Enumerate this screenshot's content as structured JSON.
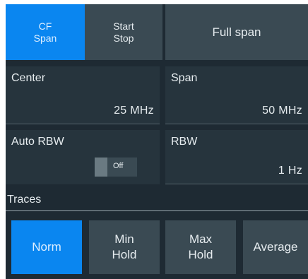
{
  "span_mode": {
    "cf_span": {
      "line1": "CF",
      "line2": "Span"
    },
    "start_stop": {
      "line1": "Start",
      "line2": "Stop"
    },
    "full_span": "Full span"
  },
  "center": {
    "label": "Center",
    "value": "25 MHz"
  },
  "span": {
    "label": "Span",
    "value": "50 MHz"
  },
  "auto_rbw": {
    "label": "Auto RBW",
    "state": "Off"
  },
  "rbw": {
    "label": "RBW",
    "value": "1 Hz"
  },
  "traces": {
    "title": "Traces",
    "buttons": [
      {
        "label": "Norm",
        "line2": ""
      },
      {
        "label": "Min",
        "line2": "Hold"
      },
      {
        "label": "Max",
        "line2": "Hold"
      },
      {
        "label": "Average",
        "line2": ""
      }
    ],
    "selected": "Norm"
  },
  "colors": {
    "background": "#1e2a33",
    "active_button": "#0a86f0",
    "inactive_button": "#3a4a53",
    "field": "#26343d"
  }
}
